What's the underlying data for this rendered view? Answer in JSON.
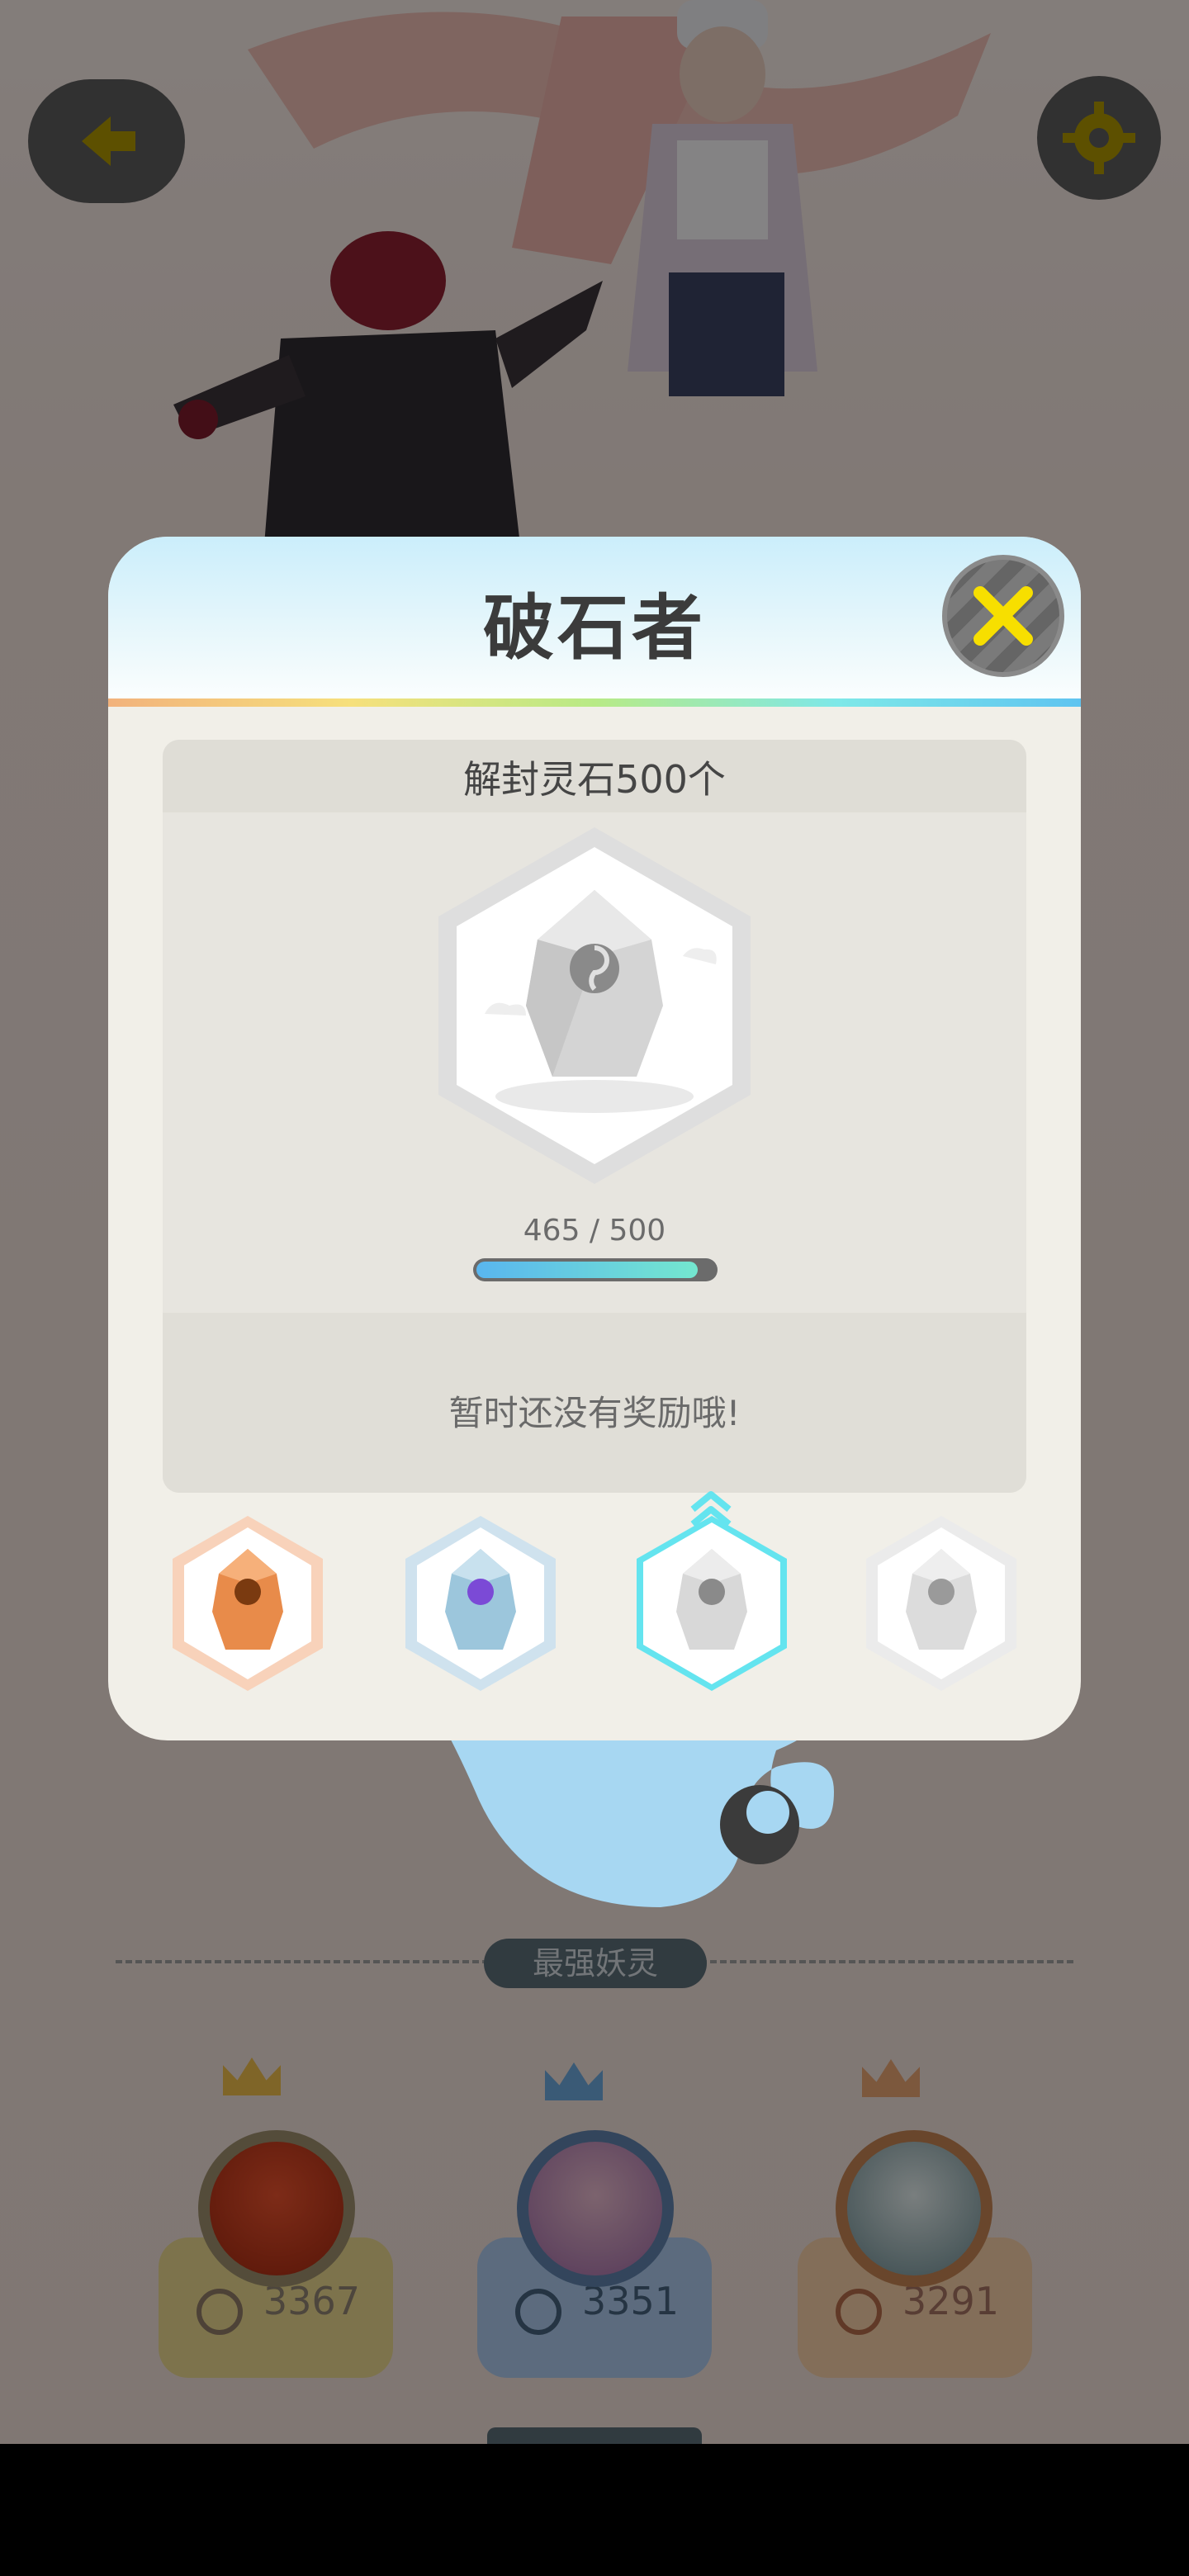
{
  "modal": {
    "title": "破石者",
    "task_description": "解封灵石500个",
    "progress": {
      "current": 465,
      "target": 500,
      "text": "465 / 500"
    },
    "reward_text": "暂时还没有奖励哦!",
    "tiers": [
      {
        "name": "bronze",
        "color": "#f0a06a",
        "state": "unlocked"
      },
      {
        "name": "silver",
        "color": "#9cc6dc",
        "state": "unlocked"
      },
      {
        "name": "gold",
        "color": "#64e4ef",
        "state": "selected"
      },
      {
        "name": "diamond",
        "color": "#e6e6e6",
        "state": "locked"
      }
    ]
  },
  "background": {
    "section_title": "最强妖灵",
    "leaderboard": [
      {
        "rank": 1,
        "score": "3367"
      },
      {
        "rank": 2,
        "score": "3351"
      },
      {
        "rank": 3,
        "score": "3291"
      }
    ]
  },
  "colors": {
    "accent_yellow": "#f7df00",
    "modal_bg": "#f1efe8"
  }
}
